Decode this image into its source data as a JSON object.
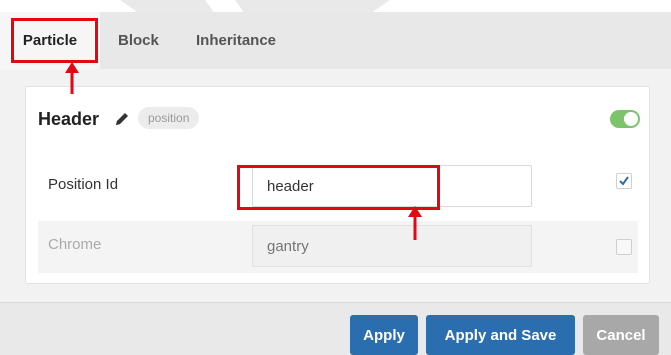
{
  "tabs": [
    {
      "label": "Particle",
      "active": true
    },
    {
      "label": "Block",
      "active": false
    },
    {
      "label": "Inheritance",
      "active": false
    }
  ],
  "card": {
    "title": "Header",
    "badge": "position",
    "enabled": true
  },
  "fields": {
    "position_id": {
      "label": "Position Id",
      "value": "header",
      "checked": true
    },
    "chrome": {
      "label": "Chrome",
      "placeholder": "gantry",
      "checked": false
    }
  },
  "footer": {
    "apply_label": "Apply",
    "apply_save_label": "Apply and Save",
    "cancel_label": "Cancel"
  },
  "colors": {
    "primary": "#2a6eb0",
    "toggle_on": "#7cc36c",
    "annotation": "#e30613"
  }
}
